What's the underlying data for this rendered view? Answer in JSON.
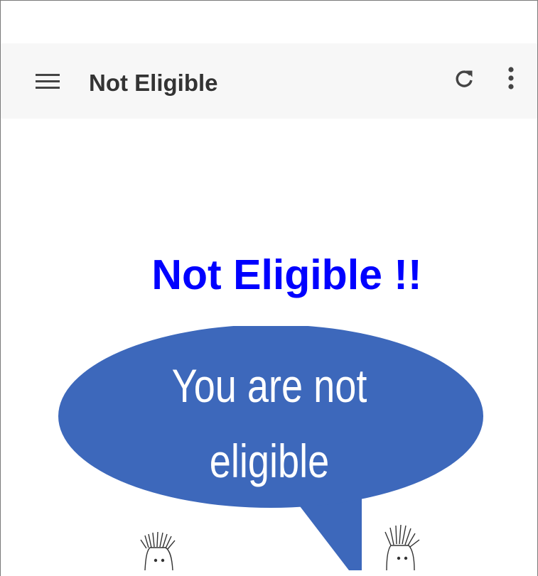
{
  "app_bar": {
    "title": "Not Eligible",
    "menu_icon": "hamburger-menu-icon",
    "refresh_icon": "refresh-icon",
    "more_icon": "more-vert-icon"
  },
  "main": {
    "heading": "Not Eligible !!",
    "speech_bubble": {
      "line1": "You are not",
      "line2": "eligible"
    }
  },
  "colors": {
    "heading": "#0000ff",
    "bubble": "#3d68bb",
    "app_bar_bg": "#f7f7f7",
    "app_bar_text": "#333333"
  }
}
